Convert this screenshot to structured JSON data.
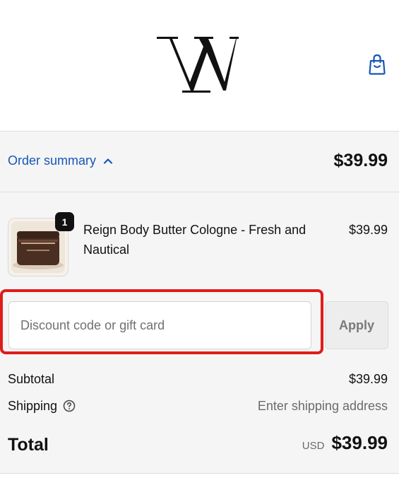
{
  "header": {
    "logo_letter": "W",
    "cart_icon": "shopping-bag-icon"
  },
  "summary": {
    "toggle_label": "Order summary",
    "toggle_icon": "chevron-up-icon",
    "toggle_total": "$39.99",
    "accent_color": "#1757b8"
  },
  "line_items": [
    {
      "quantity": "1",
      "name": "Reign Body Butter Cologne - Fresh and Nautical",
      "price": "$39.99",
      "image_icon": "product-jar-image"
    }
  ],
  "discount": {
    "placeholder": "Discount code or gift card",
    "value": "",
    "apply_label": "Apply",
    "highlight_color": "#e01b1b"
  },
  "costs": {
    "subtotal_label": "Subtotal",
    "subtotal_value": "$39.99",
    "shipping_label": "Shipping",
    "shipping_icon": "help-circle-icon",
    "shipping_value": "Enter shipping address",
    "total_label": "Total",
    "currency": "USD",
    "total_value": "$39.99"
  }
}
